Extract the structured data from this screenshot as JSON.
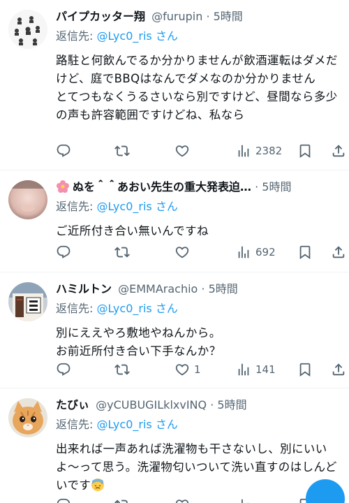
{
  "reply_prefix": "返信先: ",
  "reply_suffix": " さん",
  "reply_target": "@Lyc0_ris",
  "separator": "·",
  "tweets": [
    {
      "name": "パイプカッター翔",
      "handle": "@furupin",
      "time": "5時間",
      "text": [
        "路駐と何飲んでるか分かりませんが飲酒運転はダメだけど、庭でBBQはなんでダメなのか分かりません",
        "とてつもなくうるさいなら別ですけど、昼間なら多少の声も許容範囲ですけどね、私なら"
      ],
      "views": "2382",
      "likes": ""
    },
    {
      "name": "ぬを＾＾あおい先生の重大発表迫…",
      "handle": "",
      "time": "5時間",
      "text": [
        "ご近所付き合い無いんですね"
      ],
      "views": "692",
      "likes": ""
    },
    {
      "name": "ハミルトン",
      "handle": "@EMMArachio",
      "time": "5時間",
      "text": [
        "別にええやろ敷地やねんから。",
        "お前近所付き合い下手なんか？"
      ],
      "views": "141",
      "likes": "1"
    },
    {
      "name": "たびぃ",
      "handle": "@yCUBUGILklxvINQ",
      "time": "5時間",
      "text": [
        "出来れば一声あれば洗濯物も干さないし、別にいいよ〜って思う。洗濯物匂いついて洗い直すのはしんどいです"
      ],
      "views": "",
      "likes": ""
    }
  ],
  "icons": {
    "reply": "reply-icon",
    "retweet": "retweet-icon",
    "like": "heart-icon",
    "views": "views-icon",
    "bookmark": "bookmark-icon",
    "share": "share-icon"
  },
  "colors": {
    "accent": "#1d9bf0",
    "muted": "#536471",
    "text": "#0f1419"
  }
}
